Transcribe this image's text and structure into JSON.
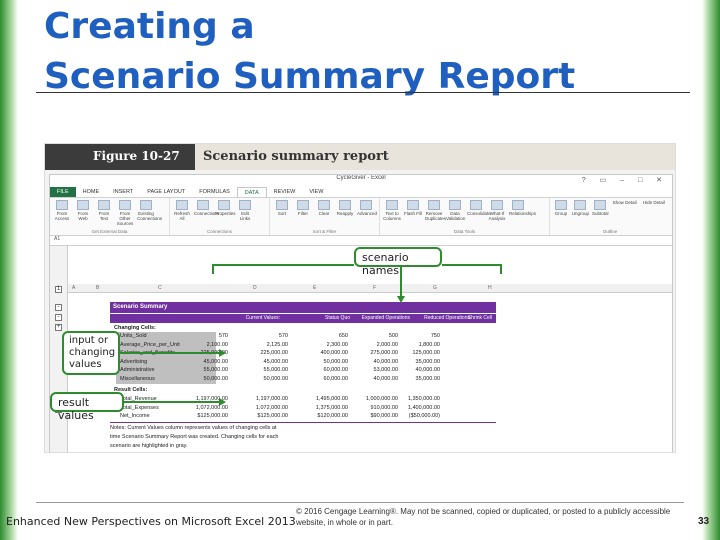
{
  "slide": {
    "title_line1": "Creating a",
    "title_line2": "Scenario Summary Report",
    "footer_left": "Enhanced New Perspectives on Microsoft Excel 2013",
    "footer_copyright": "© 2016 Cengage Learning®. May not be scanned, copied or duplicated, or posted to a publicly accessible website, in whole or in part.",
    "page_number": "33"
  },
  "figure": {
    "badge": "Figure 10-27",
    "caption": "Scenario summary report"
  },
  "excel": {
    "window_title": "CycleGiver - Excel",
    "window_controls": "? ▭ – □ ✕",
    "tabs": [
      "FILE",
      "HOME",
      "INSERT",
      "PAGE LAYOUT",
      "FORMULAS",
      "DATA",
      "REVIEW",
      "VIEW"
    ],
    "active_tab": "DATA",
    "ribbon_groups": [
      {
        "label": "Get External Data",
        "buttons": [
          "From Access",
          "From Web",
          "From Text",
          "From Other Sources",
          "Existing Connections"
        ]
      },
      {
        "label": "Connections",
        "buttons": [
          "Refresh All",
          "Connections",
          "Properties",
          "Edit Links"
        ]
      },
      {
        "label": "Sort & Filter",
        "buttons": [
          "Sort",
          "Filter",
          "Clear",
          "Reapply",
          "Advanced"
        ]
      },
      {
        "label": "Data Tools",
        "buttons": [
          "Text to Columns",
          "Flash Fill",
          "Remove Duplicates",
          "Data Validation",
          "Consolidate",
          "What-If Analysis",
          "Relationships"
        ]
      },
      {
        "label": "Outline",
        "buttons": [
          "Group",
          "Ungroup",
          "Subtotal",
          "Show Detail",
          "Hide Detail"
        ]
      }
    ],
    "name_box": "A1",
    "column_headers": [
      "A",
      "B",
      "C",
      "D",
      "E",
      "F",
      "G",
      "H"
    ],
    "sheet": {
      "title": "Scenario Summary",
      "col_headers": [
        "Current Values:",
        "Status Quo",
        "Expanded Operations",
        "Reduced Operations",
        "Shrink Cell"
      ],
      "changing_cells_label": "Changing Cells:",
      "changing_rows": [
        {
          "label": "Units_Sold",
          "values": [
            "570",
            "570",
            "650",
            "500",
            "750"
          ]
        },
        {
          "label": "Average_Price_per_Unit",
          "values": [
            "2,100.00",
            "2,125.00",
            "2,300.00",
            "2,000.00",
            "1,800.00"
          ]
        },
        {
          "label": "Salaries_and_Benefits",
          "values": [
            "225,000.00",
            "225,000.00",
            "400,000.00",
            "275,000.00",
            "125,000.00"
          ]
        },
        {
          "label": "Advertising",
          "values": [
            "45,000.00",
            "45,000.00",
            "50,000.00",
            "40,000.00",
            "35,000.00"
          ]
        },
        {
          "label": "Administrative",
          "values": [
            "55,000.00",
            "55,000.00",
            "60,000.00",
            "53,000.00",
            "40,000.00"
          ]
        },
        {
          "label": "Miscellaneous",
          "values": [
            "50,000.00",
            "50,000.00",
            "60,000.00",
            "40,000.00",
            "35,000.00"
          ]
        }
      ],
      "result_cells_label": "Result Cells:",
      "result_rows": [
        {
          "label": "Total_Revenue",
          "values": [
            "1,197,000.00",
            "1,197,000.00",
            "1,495,000.00",
            "1,000,000.00",
            "1,350,000.00"
          ]
        },
        {
          "label": "Total_Expenses",
          "values": [
            "1,072,000.00",
            "1,072,000.00",
            "1,375,000.00",
            "910,000.00",
            "1,400,000.00"
          ]
        },
        {
          "label": "Net_Income",
          "values": [
            "$125,000.00",
            "$125,000.00",
            "$120,000.00",
            "$90,000.00",
            "($50,000.00)"
          ]
        }
      ],
      "notes": [
        "Notes: Current Values column represents values of changing cells at",
        "time Scenario Summary Report was created. Changing cells for each",
        "scenario are highlighted in gray."
      ]
    }
  },
  "callouts": {
    "scenario_names": "scenario names",
    "input_values_line1": "input or",
    "input_values_line2": "changing",
    "input_values_line3": "values",
    "result_values": "result values"
  }
}
